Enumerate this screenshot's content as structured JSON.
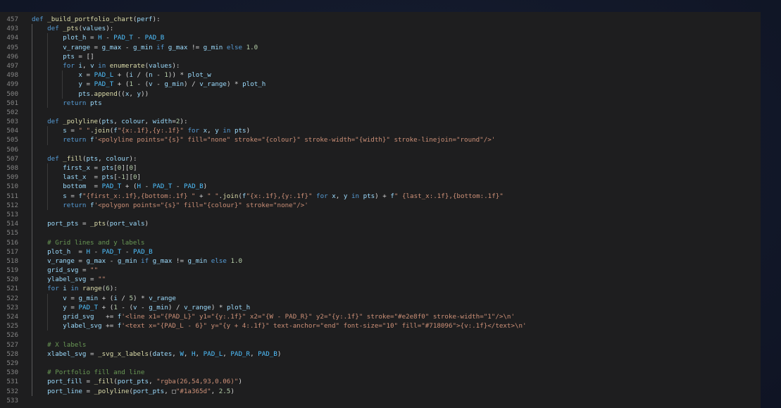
{
  "editor": {
    "lines": [
      {
        "n": "457",
        "text": "def _build_portfolio_chart(perf):",
        "indent": 0
      },
      {
        "n": "493",
        "text": "    def _pts(values):",
        "indent": 1
      },
      {
        "n": "494",
        "text": "        plot_h = H - PAD_T - PAD_B",
        "indent": 2
      },
      {
        "n": "495",
        "text": "        v_range = g_max - g_min if g_max != g_min else 1.0",
        "indent": 2
      },
      {
        "n": "496",
        "text": "        pts = []",
        "indent": 2
      },
      {
        "n": "497",
        "text": "        for i, v in enumerate(values):",
        "indent": 2
      },
      {
        "n": "498",
        "text": "            x = PAD_L + (i / (n - 1)) * plot_w",
        "indent": 3
      },
      {
        "n": "499",
        "text": "            y = PAD_T + (1 - (v - g_min) / v_range) * plot_h",
        "indent": 3
      },
      {
        "n": "500",
        "text": "            pts.append((x, y))",
        "indent": 3
      },
      {
        "n": "501",
        "text": "        return pts",
        "indent": 2
      },
      {
        "n": "502",
        "text": "",
        "indent": 1
      },
      {
        "n": "503",
        "text": "    def _polyline(pts, colour, width=2):",
        "indent": 1
      },
      {
        "n": "504",
        "text": "        s = \" \".join(f\"{x:.1f},{y:.1f}\" for x, y in pts)",
        "indent": 2
      },
      {
        "n": "505",
        "text": "        return f'<polyline points=\"{s}\" fill=\"none\" stroke=\"{colour}\" stroke-width=\"{width}\" stroke-linejoin=\"round\"/>'",
        "indent": 2
      },
      {
        "n": "506",
        "text": "",
        "indent": 1
      },
      {
        "n": "507",
        "text": "    def _fill(pts, colour):",
        "indent": 1
      },
      {
        "n": "508",
        "text": "        first_x = pts[0][0]",
        "indent": 2
      },
      {
        "n": "509",
        "text": "        last_x  = pts[-1][0]",
        "indent": 2
      },
      {
        "n": "510",
        "text": "        bottom  = PAD_T + (H - PAD_T - PAD_B)",
        "indent": 2
      },
      {
        "n": "511",
        "text": "        s = f\"{first_x:.1f},{bottom:.1f} \" + \" \".join(f\"{x:.1f},{y:.1f}\" for x, y in pts) + f\" {last_x:.1f},{bottom:.1f}\"",
        "indent": 2
      },
      {
        "n": "512",
        "text": "        return f'<polygon points=\"{s}\" fill=\"{colour}\" stroke=\"none\"/>'",
        "indent": 2
      },
      {
        "n": "513",
        "text": "",
        "indent": 1
      },
      {
        "n": "514",
        "text": "    port_pts = _pts(port_vals)",
        "indent": 1
      },
      {
        "n": "515",
        "text": "",
        "indent": 1
      },
      {
        "n": "516",
        "text": "    # Grid lines and y labels",
        "indent": 1
      },
      {
        "n": "517",
        "text": "    plot_h  = H - PAD_T - PAD_B",
        "indent": 1
      },
      {
        "n": "518",
        "text": "    v_range = g_max - g_min if g_max != g_min else 1.0",
        "indent": 1
      },
      {
        "n": "519",
        "text": "    grid_svg = \"\"",
        "indent": 1
      },
      {
        "n": "520",
        "text": "    ylabel_svg = \"\"",
        "indent": 1
      },
      {
        "n": "521",
        "text": "    for i in range(6):",
        "indent": 1
      },
      {
        "n": "522",
        "text": "        v = g_min + (i / 5) * v_range",
        "indent": 2
      },
      {
        "n": "523",
        "text": "        y = PAD_T + (1 - (v - g_min) / v_range) * plot_h",
        "indent": 2
      },
      {
        "n": "524",
        "text": "        grid_svg   += f'<line x1=\"{PAD_L}\" y1=\"{y:.1f}\" x2=\"{W - PAD_R}\" y2=\"{y:.1f}\" stroke=\"#e2e8f0\" stroke-width=\"1\"/>\\n'",
        "indent": 2
      },
      {
        "n": "525",
        "text": "        ylabel_svg += f'<text x=\"{PAD_L - 6}\" y=\"{y + 4:.1f}\" text-anchor=\"end\" font-size=\"10\" fill=\"#718096\">{v:.1f}</text>\\n'",
        "indent": 2
      },
      {
        "n": "526",
        "text": "",
        "indent": 1
      },
      {
        "n": "527",
        "text": "    # X labels",
        "indent": 1
      },
      {
        "n": "528",
        "text": "    xlabel_svg = _svg_x_labels(dates, W, H, PAD_L, PAD_R, PAD_B)",
        "indent": 1
      },
      {
        "n": "529",
        "text": "",
        "indent": 1
      },
      {
        "n": "530",
        "text": "    # Portfolio fill and line",
        "indent": 1
      },
      {
        "n": "531",
        "text": "    port_fill = _fill(port_pts, \"rgba(26,54,93,0.06)\")",
        "indent": 1
      },
      {
        "n": "532",
        "text": "    port_line = _polyline(port_pts, □\"#1a365d\", 2.5)",
        "indent": 1
      },
      {
        "n": "533",
        "text": "",
        "indent": 0
      }
    ]
  },
  "colors": {
    "background": "#141a2c",
    "editor_background": "#1e1e1f",
    "line_number": "#858585",
    "keyword": "#569cd6",
    "function": "#dcdcaa",
    "string": "#ce9178",
    "number": "#b5cea8",
    "comment": "#6a9955",
    "variable": "#9cdcfe",
    "text": "#d4d4d4"
  }
}
